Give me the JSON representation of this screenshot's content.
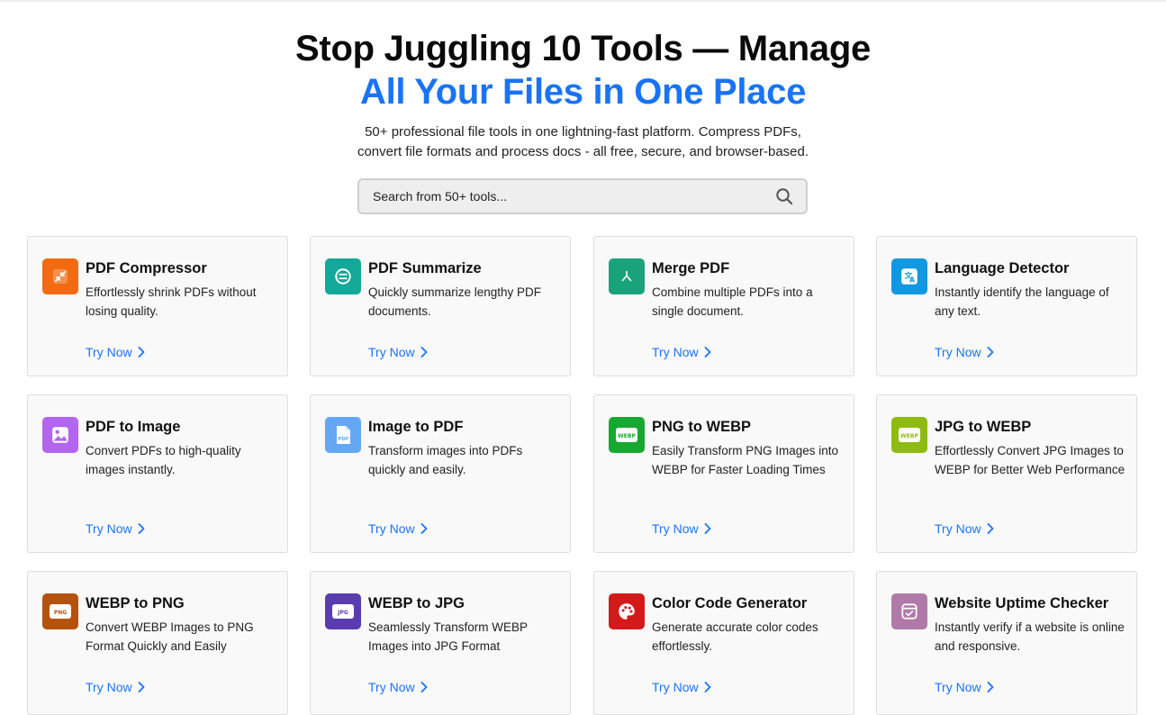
{
  "hero": {
    "title_line1": "Stop Juggling 10 Tools — Manage",
    "title_line2": "All Your Files in One Place",
    "subtitle_line1": "50+ professional file tools in one lightning-fast platform. Compress PDFs,",
    "subtitle_line2": "convert file formats and process docs - all free, secure, and browser-based."
  },
  "search": {
    "placeholder": "Search from 50+ tools..."
  },
  "colors": {
    "accent_blue": "#1a73f5"
  },
  "tools": [
    {
      "title": "PDF Compressor",
      "desc": "Effortlessly shrink PDFs without losing quality.",
      "cta": "Try Now",
      "icon": "compress-icon",
      "color": "#f26b12"
    },
    {
      "title": "PDF Summarize",
      "desc": "Quickly summarize lengthy PDF documents.",
      "cta": "Try Now",
      "icon": "summarize-icon",
      "color": "#14a89a"
    },
    {
      "title": "Merge PDF",
      "desc": "Combine multiple PDFs into a single document.",
      "cta": "Try Now",
      "icon": "merge-icon",
      "color": "#1aa37a"
    },
    {
      "title": "Language Detector",
      "desc": "Instantly identify the language of any text.",
      "cta": "Try Now",
      "icon": "translate-icon",
      "color": "#1298e0"
    },
    {
      "title": "PDF to Image",
      "desc": "Convert PDFs to high-quality images instantly.",
      "cta": "Try Now",
      "icon": "image-icon",
      "color": "#b165f0"
    },
    {
      "title": "Image to PDF",
      "desc": "Transform images into PDFs quickly and easily.",
      "cta": "Try Now",
      "icon": "pdf-file-icon",
      "color": "#64a8f5",
      "badge": "PDF"
    },
    {
      "title": "PNG to WEBP",
      "desc": "Easily Transform PNG Images into WEBP for Faster Loading Times",
      "cta": "Try Now",
      "icon": "webp-badge-icon",
      "color": "#17a832",
      "badge": "WEBP"
    },
    {
      "title": "JPG to WEBP",
      "desc": "Effortlessly Convert JPG Images to WEBP for Better Web Performance",
      "cta": "Try Now",
      "icon": "webp-badge-icon",
      "color": "#8dbb12",
      "badge": "WEBP"
    },
    {
      "title": "WEBP to PNG",
      "desc": "Convert WEBP Images to PNG Format Quickly and Easily",
      "cta": "Try Now",
      "icon": "png-badge-icon",
      "color": "#b5520e",
      "badge": "PNG"
    },
    {
      "title": "WEBP to JPG",
      "desc": "Seamlessly Transform WEBP Images into JPG Format",
      "cta": "Try Now",
      "icon": "jpg-badge-icon",
      "color": "#5b3bb0",
      "badge": "JPG"
    },
    {
      "title": "Color Code Generator",
      "desc": "Generate accurate color codes effortlessly.",
      "cta": "Try Now",
      "icon": "palette-icon",
      "color": "#d31a1a"
    },
    {
      "title": "Website Uptime Checker",
      "desc": "Instantly verify if a website is online and responsive.",
      "cta": "Try Now",
      "icon": "uptime-icon",
      "color": "#b07aa8"
    }
  ]
}
